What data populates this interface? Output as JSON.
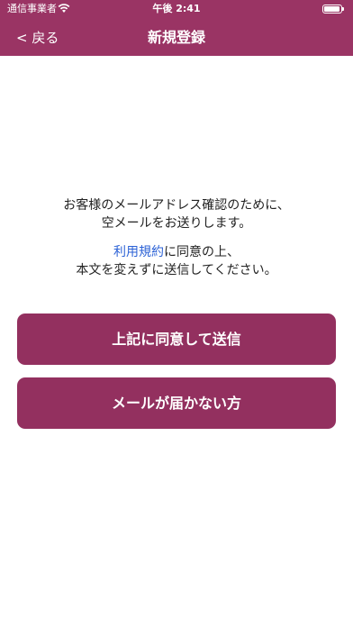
{
  "status_bar": {
    "carrier": "通信事業者",
    "time": "午後 2:41",
    "wifi_icon": "wifi-icon",
    "battery_icon": "battery-icon"
  },
  "nav": {
    "back_label": "< 戻る",
    "title": "新規登録"
  },
  "message": {
    "line1": "お客様のメールアドレス確認のために、",
    "line2": "空メールをお送りします。",
    "terms_link": "利用規約",
    "line3_rest": "に同意の上、",
    "line4": "本文を変えずに送信してください。"
  },
  "buttons": {
    "agree_send": "上記に同意して送信",
    "not_received": "メールが届かない方"
  },
  "colors": {
    "header": "#9a3464",
    "button": "#93305f",
    "link": "#2c62d6"
  }
}
